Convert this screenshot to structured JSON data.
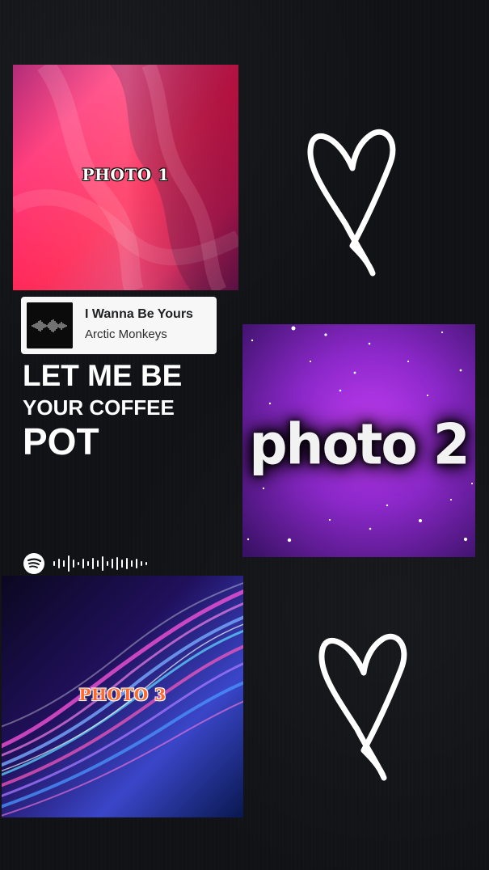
{
  "photos": {
    "photo1": "PHOTO 1",
    "photo2": "photo 2",
    "photo3": "PHOTO 3"
  },
  "song": {
    "title": "I Wanna Be Yours",
    "artist": "Arctic Monkeys"
  },
  "lyrics": {
    "line1": "LET ME BE",
    "line2": "YOUR COFFEE",
    "line3": "POT"
  },
  "icons": {
    "heart1": "heart-outline-icon",
    "heart2": "heart-outline-icon",
    "spotify": "spotify-logo-icon",
    "spotify_code": "spotify-code-icon",
    "album_art": "soundwave-icon"
  },
  "colors": {
    "background": "#101216",
    "photo1_accent": "#ff1d58",
    "photo2_accent": "#8a2ad0",
    "photo3_accent": "#3b5cff",
    "text": "#ffffff"
  }
}
